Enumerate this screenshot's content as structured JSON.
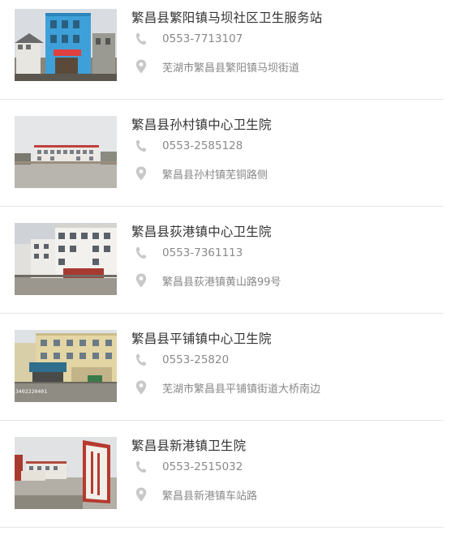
{
  "items": [
    {
      "name": "繁昌县繁阳镇马坝社区卫生服务站",
      "phone": "0553-7713107",
      "address": "芜湖市繁昌县繁阳镇马坝街道",
      "phone_icon": "phone-icon",
      "address_icon": "map-pin-icon"
    },
    {
      "name": "繁昌县孙村镇中心卫生院",
      "phone": "0553-2585128",
      "address": "繁昌县孙村镇芜铜路侧",
      "phone_icon": "phone-icon",
      "address_icon": "map-pin-icon"
    },
    {
      "name": "繁昌县荻港镇中心卫生院",
      "phone": "0553-7361113",
      "address": "繁昌县荻港镇黄山路99号",
      "phone_icon": "phone-icon",
      "address_icon": "map-pin-icon"
    },
    {
      "name": "繁昌县平铺镇中心卫生院",
      "phone": "0553-25820",
      "address": "芜湖市繁昌县平铺镇街道大桥南边",
      "photo_caption": "3402220401",
      "phone_icon": "phone-icon",
      "address_icon": "map-pin-icon"
    },
    {
      "name": "繁昌县新港镇卫生院",
      "phone": "0553-2515032",
      "address": "繁昌县新港镇车站路",
      "phone_icon": "phone-icon",
      "address_icon": "map-pin-icon"
    }
  ],
  "colors": {
    "title": "#333333",
    "secondary_text": "#888888",
    "icon": "#c8c8c8",
    "divider": "#e5e5e5"
  }
}
